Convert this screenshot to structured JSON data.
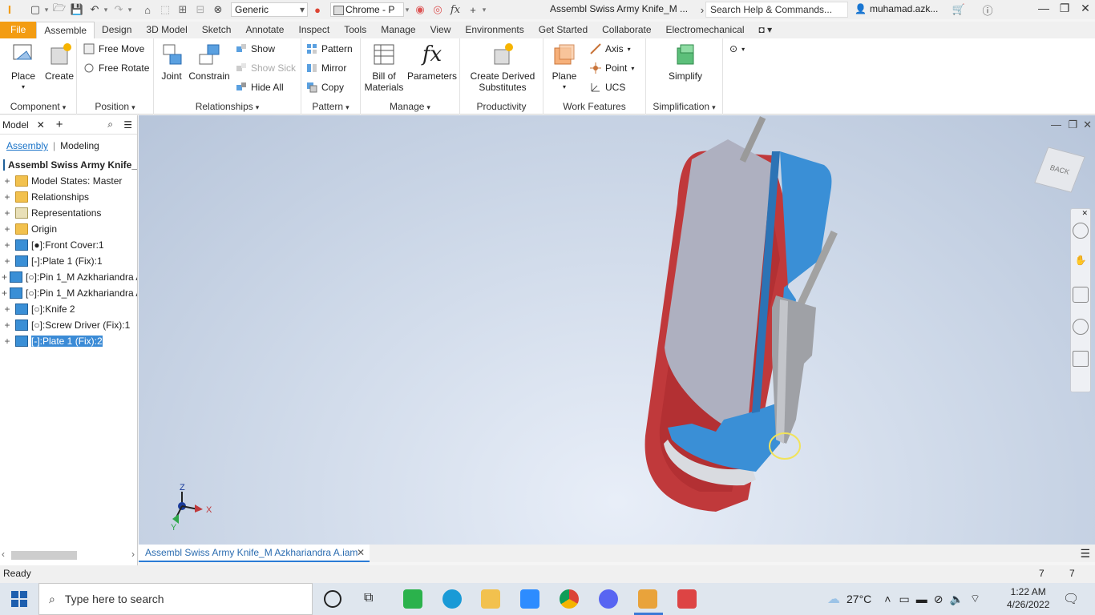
{
  "titlebar": {
    "appearance": "Generic",
    "material": "Chrome - P",
    "doc_title": "Assembl Swiss Army Knife_M ...",
    "search_placeholder": "Search Help & Commands...",
    "user": "muhamad.azk..."
  },
  "tabs": [
    "File",
    "Assemble",
    "Design",
    "3D Model",
    "Sketch",
    "Annotate",
    "Inspect",
    "Tools",
    "Manage",
    "View",
    "Environments",
    "Get Started",
    "Collaborate",
    "Electromechanical"
  ],
  "ribbon": {
    "component": {
      "title": "Component",
      "place": "Place",
      "create": "Create"
    },
    "position": {
      "title": "Position",
      "free_move": "Free Move",
      "free_rotate": "Free Rotate"
    },
    "relationships": {
      "title": "Relationships",
      "joint": "Joint",
      "constrain": "Constrain",
      "show": "Show",
      "show_sick": "Show Sick",
      "hide_all": "Hide All"
    },
    "pattern": {
      "title": "Pattern",
      "pattern": "Pattern",
      "mirror": "Mirror",
      "copy": "Copy"
    },
    "manage": {
      "title": "Manage",
      "bom_1": "Bill of",
      "bom_2": "Materials",
      "parameters": "Parameters"
    },
    "productivity": {
      "title": "Productivity",
      "derived_1": "Create Derived",
      "derived_2": "Substitutes"
    },
    "work_features": {
      "title": "Work Features",
      "plane": "Plane",
      "axis": "Axis",
      "point": "Point",
      "ucs": "UCS"
    },
    "simplification": {
      "title": "Simplification",
      "simplify": "Simplify"
    }
  },
  "browser": {
    "tab_label": "Model",
    "mode_assembly": "Assembly",
    "mode_modeling": "Modeling",
    "root": "Assembl Swiss Army Knife_",
    "items": [
      {
        "label": "Model States: Master",
        "icon": "folder"
      },
      {
        "label": "Relationships",
        "icon": "folder"
      },
      {
        "label": "Representations",
        "icon": "repr"
      },
      {
        "label": "Origin",
        "icon": "folder"
      },
      {
        "label": "[●]:Front Cover:1",
        "icon": "part"
      },
      {
        "label": "[-]:Plate 1 (Fix):1",
        "icon": "part"
      },
      {
        "label": "[○]:Pin 1_M Azkhariandra Ar",
        "icon": "part"
      },
      {
        "label": "[○]:Pin 1_M Azkhariandra Ar",
        "icon": "part"
      },
      {
        "label": "[○]:Knife 2",
        "icon": "part"
      },
      {
        "label": "[○]:Screw Driver (Fix):1",
        "icon": "part"
      },
      {
        "label": "[-]:Plate 1 (Fix):2",
        "icon": "part",
        "selected": true
      }
    ]
  },
  "viewport": {
    "viewcube_label": "BACK",
    "axis_x": "X",
    "axis_y": "Y",
    "axis_z": "Z"
  },
  "doc_tab": "Assembl Swiss Army Knife_M Azkhariandra A.iam",
  "status": {
    "text": "Ready",
    "count_1": "7",
    "count_2": "7"
  },
  "taskbar": {
    "search_placeholder": "Type here to search",
    "temperature": "27°C",
    "time": "1:22 AM",
    "date": "4/26/2022"
  },
  "colors": {
    "file_tab": "#f39c12",
    "blue_part": "#3a8fd6",
    "red_part": "#c0393b",
    "selection": "#3b8bd6"
  }
}
